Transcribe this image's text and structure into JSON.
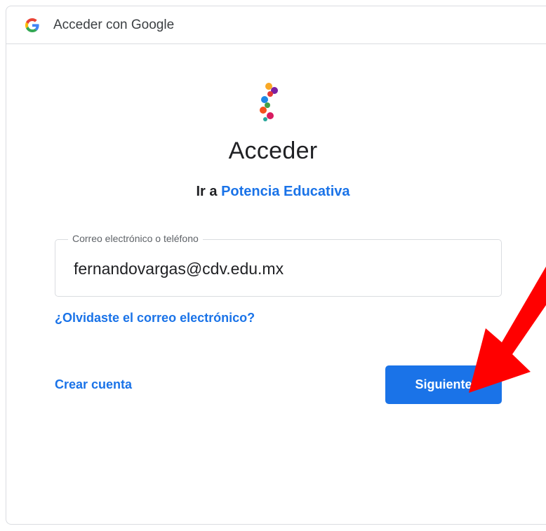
{
  "titlebar": {
    "icon": "google-g-icon",
    "title": "Acceder con Google"
  },
  "app_logo_icon": "potencia-educativa-logo",
  "heading": "Acceder",
  "subheading": {
    "prefix": "Ir a",
    "app_name": "Potencia Educativa"
  },
  "email_field": {
    "label": "Correo electrónico o teléfono",
    "value": "fernandovargas@cdv.edu.mx"
  },
  "forgot_email_link": "¿Olvidaste el correo electrónico?",
  "create_account_link": "Crear cuenta",
  "next_button": "Siguiente",
  "annotation": {
    "icon": "red-arrow-icon",
    "color": "#ff0000"
  },
  "colors": {
    "accent": "#1a73e8",
    "text": "#202124",
    "border": "#dadce0"
  }
}
